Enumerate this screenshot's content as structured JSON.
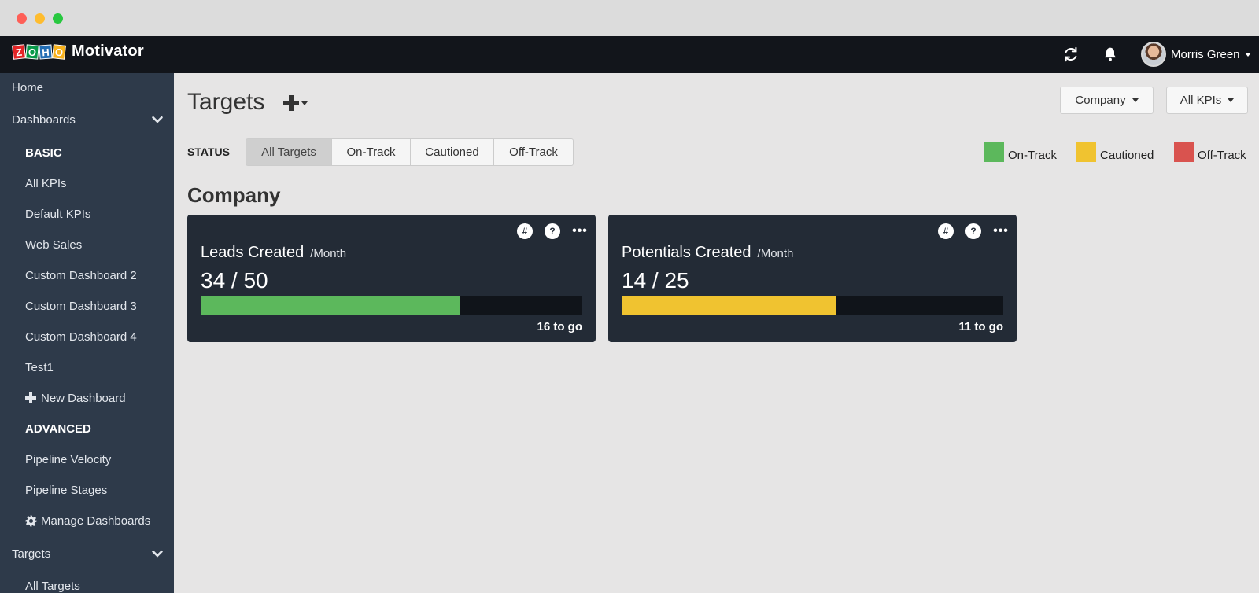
{
  "window": {
    "controls": [
      "close",
      "minimize",
      "maximize"
    ]
  },
  "topbar": {
    "logo_letters": [
      "Z",
      "O",
      "H",
      "O"
    ],
    "logo_colors": [
      "#e42527",
      "#089949",
      "#226db4",
      "#f9b21d"
    ],
    "app_name": "Motivator",
    "refresh_icon": "refresh-icon",
    "bell_icon": "bell-icon",
    "user_name": "Morris Green"
  },
  "sidebar": {
    "home": "Home",
    "dashboards": "Dashboards",
    "basic_header": "BASIC",
    "basic_items": [
      "All KPIs",
      "Default KPIs",
      "Web Sales",
      "Custom Dashboard 2",
      "Custom Dashboard 3",
      "Custom Dashboard 4",
      "Test1"
    ],
    "new_dashboard": "New Dashboard",
    "advanced_header": "ADVANCED",
    "advanced_items": [
      "Pipeline Velocity",
      "Pipeline Stages"
    ],
    "manage_dashboards": "Manage Dashboards",
    "targets": "Targets",
    "all_targets": "All Targets"
  },
  "main": {
    "title": "Targets",
    "company_dropdown": "Company",
    "kpis_dropdown": "All KPIs",
    "status_label": "STATUS",
    "status_filters": [
      "All Targets",
      "On-Track",
      "Cautioned",
      "Off-Track"
    ],
    "active_filter": "All Targets",
    "legend": [
      {
        "label": "On-Track",
        "color": "#5cb85c"
      },
      {
        "label": "Cautioned",
        "color": "#f0c330"
      },
      {
        "label": "Off-Track",
        "color": "#d9534f"
      }
    ],
    "section_title": "Company",
    "cards": [
      {
        "title": "Leads Created",
        "period": "/Month",
        "value": "34 / 50",
        "achieved": 34,
        "target": 50,
        "to_go": "16 to go",
        "color": "#5cb85c"
      },
      {
        "title": "Potentials Created",
        "period": "/Month",
        "value": "14 / 25",
        "achieved": 14,
        "target": 25,
        "to_go": "11 to go",
        "color": "#f0c330"
      }
    ],
    "card_icons": {
      "hash": "#",
      "help": "?",
      "more": "•••"
    }
  }
}
